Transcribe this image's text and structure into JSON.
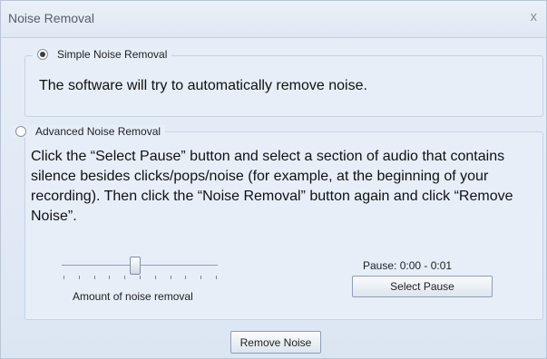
{
  "dialog": {
    "title": "Noise Removal",
    "close_glyph": "x"
  },
  "simple": {
    "option_label": "Simple Noise Removal",
    "selected": true,
    "description": "The software will try to automatically remove noise."
  },
  "advanced": {
    "option_label": "Advanced Noise Removal",
    "selected": false,
    "description": "Click the “Select Pause” button and select a section of audio that contains silence besides clicks/pops/noise (for example, at the beginning of your recording). Then click the “Noise Removal” button again and click “Remove Noise”.",
    "slider_label": "Amount of noise removal",
    "slider_level_percent": 47,
    "pause_text": "Pause: 0:00 - 0:01",
    "select_pause_label": "Select Pause"
  },
  "footer": {
    "remove_noise_label": "Remove Noise"
  }
}
